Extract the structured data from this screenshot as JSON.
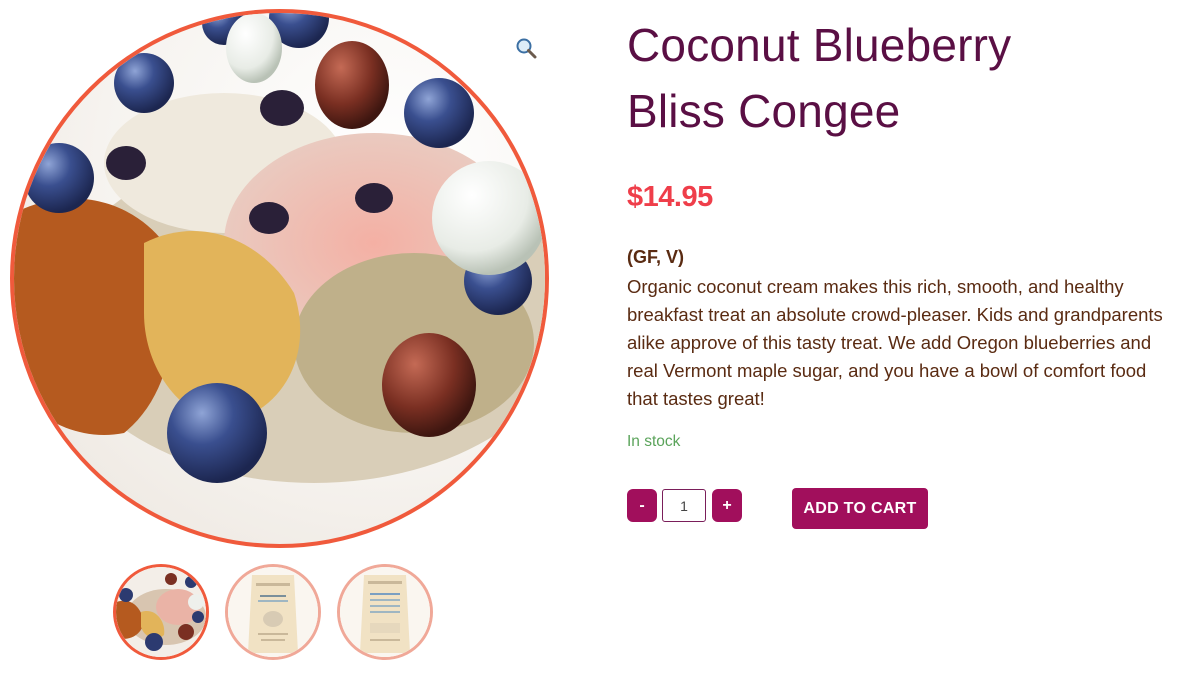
{
  "product": {
    "title_line1": "Coconut Blueberry",
    "title_line2": "Bliss Congee",
    "price": "$14.95",
    "tags": "(GF, V)",
    "description": "Organic coconut cream makes this rich, smooth, and healthy breakfast treat an absolute crowd-pleaser. Kids and grandparents alike approve of this tasty treat. We add Oregon blueberries and real Vermont maple sugar, and you have a bowl of comfort food that tastes great!",
    "stock": "In stock"
  },
  "gallery": {
    "zoom_icon": "magnifier-icon",
    "thumbnails": [
      {
        "name": "ingredients-photo",
        "active": true
      },
      {
        "name": "package-front",
        "active": false
      },
      {
        "name": "package-back",
        "active": false
      }
    ]
  },
  "cart": {
    "minus_label": "-",
    "quantity": "1",
    "plus_label": "+",
    "add_label": "ADD TO CART"
  },
  "colors": {
    "title": "#5a0f44",
    "price": "#ef3e4a",
    "body_text": "#5a2b12",
    "stock": "#5aa35a",
    "button": "#a10f5c",
    "image_ring": "#f05a3c"
  }
}
